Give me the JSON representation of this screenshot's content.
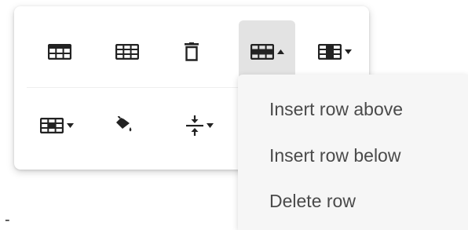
{
  "toolbar": {
    "row1": [
      {
        "icon": "table-icon"
      },
      {
        "icon": "table-columns-icon"
      },
      {
        "icon": "trash-icon"
      },
      {
        "icon": "table-row-icon",
        "dropdown": true,
        "active": true
      },
      {
        "icon": "table-column-icon",
        "dropdown": true
      }
    ],
    "row2": [
      {
        "icon": "table-cell-icon",
        "dropdown": true
      },
      {
        "icon": "fill-bucket-icon"
      },
      {
        "icon": "vertical-align-icon",
        "dropdown": true
      }
    ]
  },
  "menu": {
    "items": [
      {
        "label": "Insert row above"
      },
      {
        "label": "Insert row below"
      },
      {
        "label": "Delete row"
      }
    ],
    "background": "#f6f6f6"
  },
  "footer": {
    "text": "-"
  },
  "colors": {
    "icon": "#222222",
    "active_background": "#e3e3e3",
    "menu_text": "#4a4a4a"
  }
}
